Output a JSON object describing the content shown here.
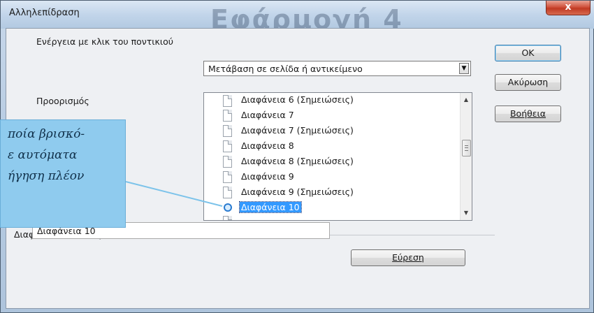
{
  "window": {
    "title": "Αλληλεπίδραση",
    "background_title": "Εφάρμογή 4",
    "close_label": "x"
  },
  "form": {
    "action_label": "Ενέργεια με κλικ του ποντικιού",
    "action_value": "Μετάβαση σε σελίδα ή αντικείμενο",
    "target_label": "Προορισμός",
    "group_label": "Διαφάνεια / Αντικείμενο",
    "object_value": "Διαφάνεια 10"
  },
  "buttons": {
    "ok": "OK",
    "cancel": "Ακύρωση",
    "help": "Βοήθεια",
    "find": "Εύρεση"
  },
  "list": {
    "items": [
      "Διαφάνεια 6 (Σημειώσεις)",
      "Διαφάνεια 7",
      "Διαφάνεια 7 (Σημειώσεις)",
      "Διαφάνεια 8",
      "Διαφάνεια 8 (Σημειώσεις)",
      "Διαφάνεια 9",
      "Διαφάνεια 9 (Σημειώσεις)",
      "Διαφάνεια 10"
    ],
    "selected": "Διαφάνεια 10"
  },
  "callout": {
    "lines": [
      "ποία βρισκό-",
      "ε αυτόματα",
      "ήγηση πλέον"
    ]
  }
}
